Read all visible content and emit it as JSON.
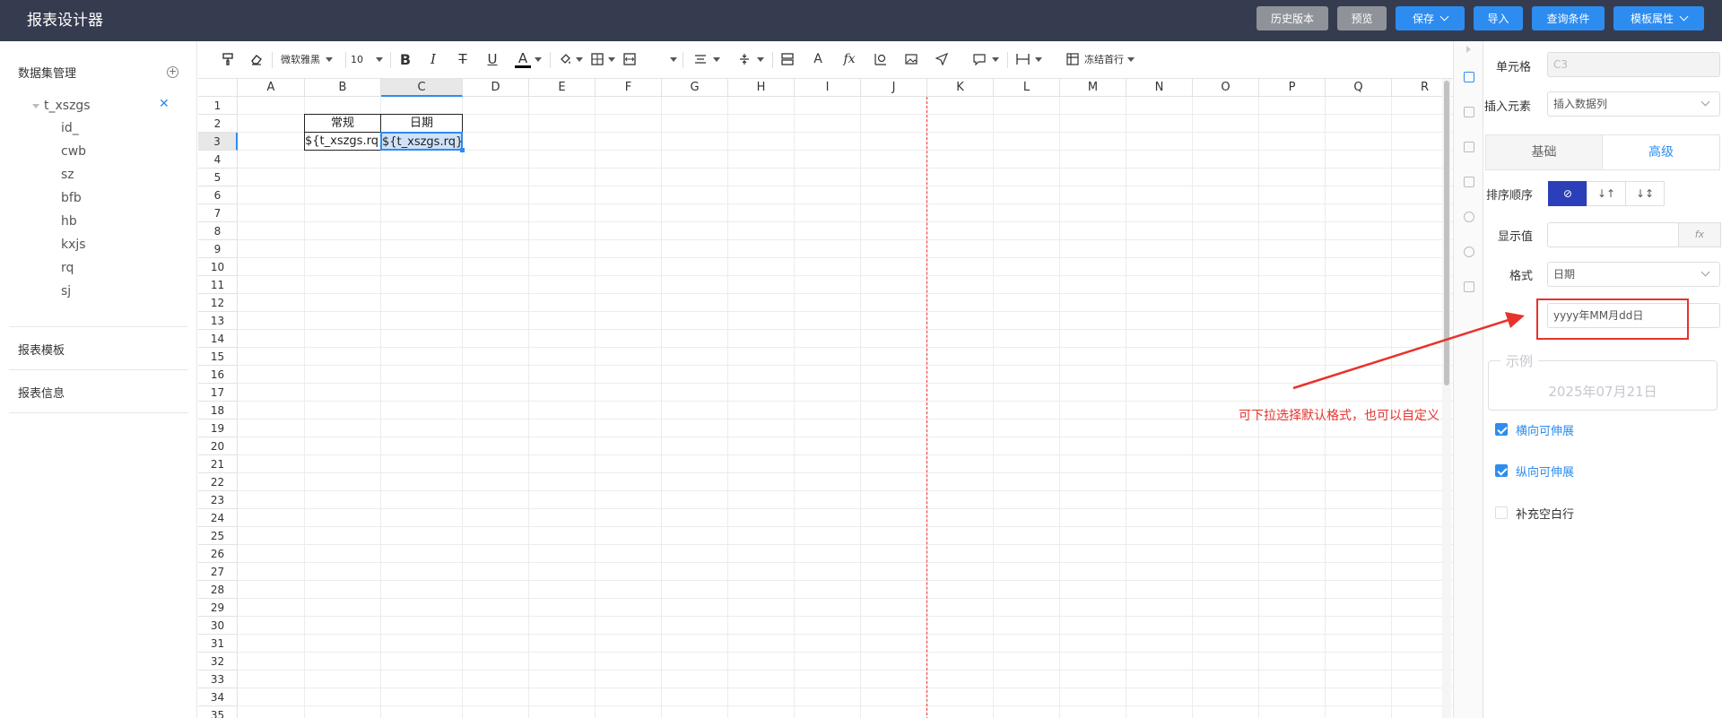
{
  "app": {
    "title": "报表设计器"
  },
  "topbar": {
    "buttons": [
      {
        "label": "历史版本",
        "style": "gray"
      },
      {
        "label": "预览",
        "style": "gray"
      },
      {
        "label": "保存",
        "style": "blue",
        "dropdown": true
      },
      {
        "label": "导入",
        "style": "blue"
      },
      {
        "label": "查询条件",
        "style": "blue"
      },
      {
        "label": "模板属性",
        "style": "blue",
        "dropdown": true
      }
    ]
  },
  "leftpanel": {
    "heading": "数据集管理",
    "dataset": {
      "name": "t_xszgs",
      "fields": [
        "id_",
        "cwb",
        "sz",
        "bfb",
        "hb",
        "kxjs",
        "rq",
        "sj"
      ]
    },
    "sections": [
      "报表模板",
      "报表信息"
    ]
  },
  "toolbar": {
    "font_family": "微软雅黑",
    "font_size": "10",
    "freeze_label": "冻结首行"
  },
  "sheet": {
    "columns": [
      "A",
      "B",
      "C",
      "D",
      "E",
      "F",
      "G",
      "H",
      "I",
      "J",
      "K",
      "L",
      "M",
      "N",
      "O",
      "P",
      "Q",
      "R"
    ],
    "selected_column": "C",
    "rows": [
      "1",
      "2",
      "3",
      "4",
      "5",
      "6",
      "7",
      "8",
      "9",
      "10",
      "11",
      "12",
      "13",
      "14",
      "15",
      "16",
      "17",
      "18",
      "19",
      "20",
      "21",
      "22",
      "23",
      "24",
      "25",
      "26",
      "27",
      "28",
      "29",
      "30",
      "31",
      "32",
      "33",
      "34",
      "35"
    ],
    "selected_row": "3",
    "cells": {
      "b2": "常规",
      "c2": "日期",
      "b3": "${t_xszgs.rq}",
      "c3": "${t_xszgs.rq}"
    }
  },
  "rightpanel": {
    "cell_label": "单元格",
    "cell_value": "C3",
    "insert_label": "插入元素",
    "insert_value": "插入数据列",
    "tabs": [
      "基础",
      "高级"
    ],
    "active_tab": "高级",
    "sort_label": "排序顺序",
    "sort_options": [
      "⊘",
      "↓↑",
      "↓↕"
    ],
    "display_label": "显示值",
    "display_value": "",
    "fx_label": "fx",
    "format_label": "格式",
    "format_value": "日期",
    "format_pattern": "yyyy年MM月dd日",
    "example_legend": "示例",
    "example_value": "2025年07月21日",
    "checkboxes": [
      {
        "label": "横向可伸展",
        "checked": true
      },
      {
        "label": "纵向可伸展",
        "checked": true
      },
      {
        "label": "补充空白行",
        "checked": false
      }
    ]
  },
  "annotation": {
    "text": "可下拉选择默认格式，也可以自定义",
    "color": "#e8322b"
  },
  "colors": {
    "topbar": "#363c4f",
    "accent": "#2d8cf0",
    "button_gray": "#8f9399",
    "sort_active": "#2b3fb8"
  }
}
